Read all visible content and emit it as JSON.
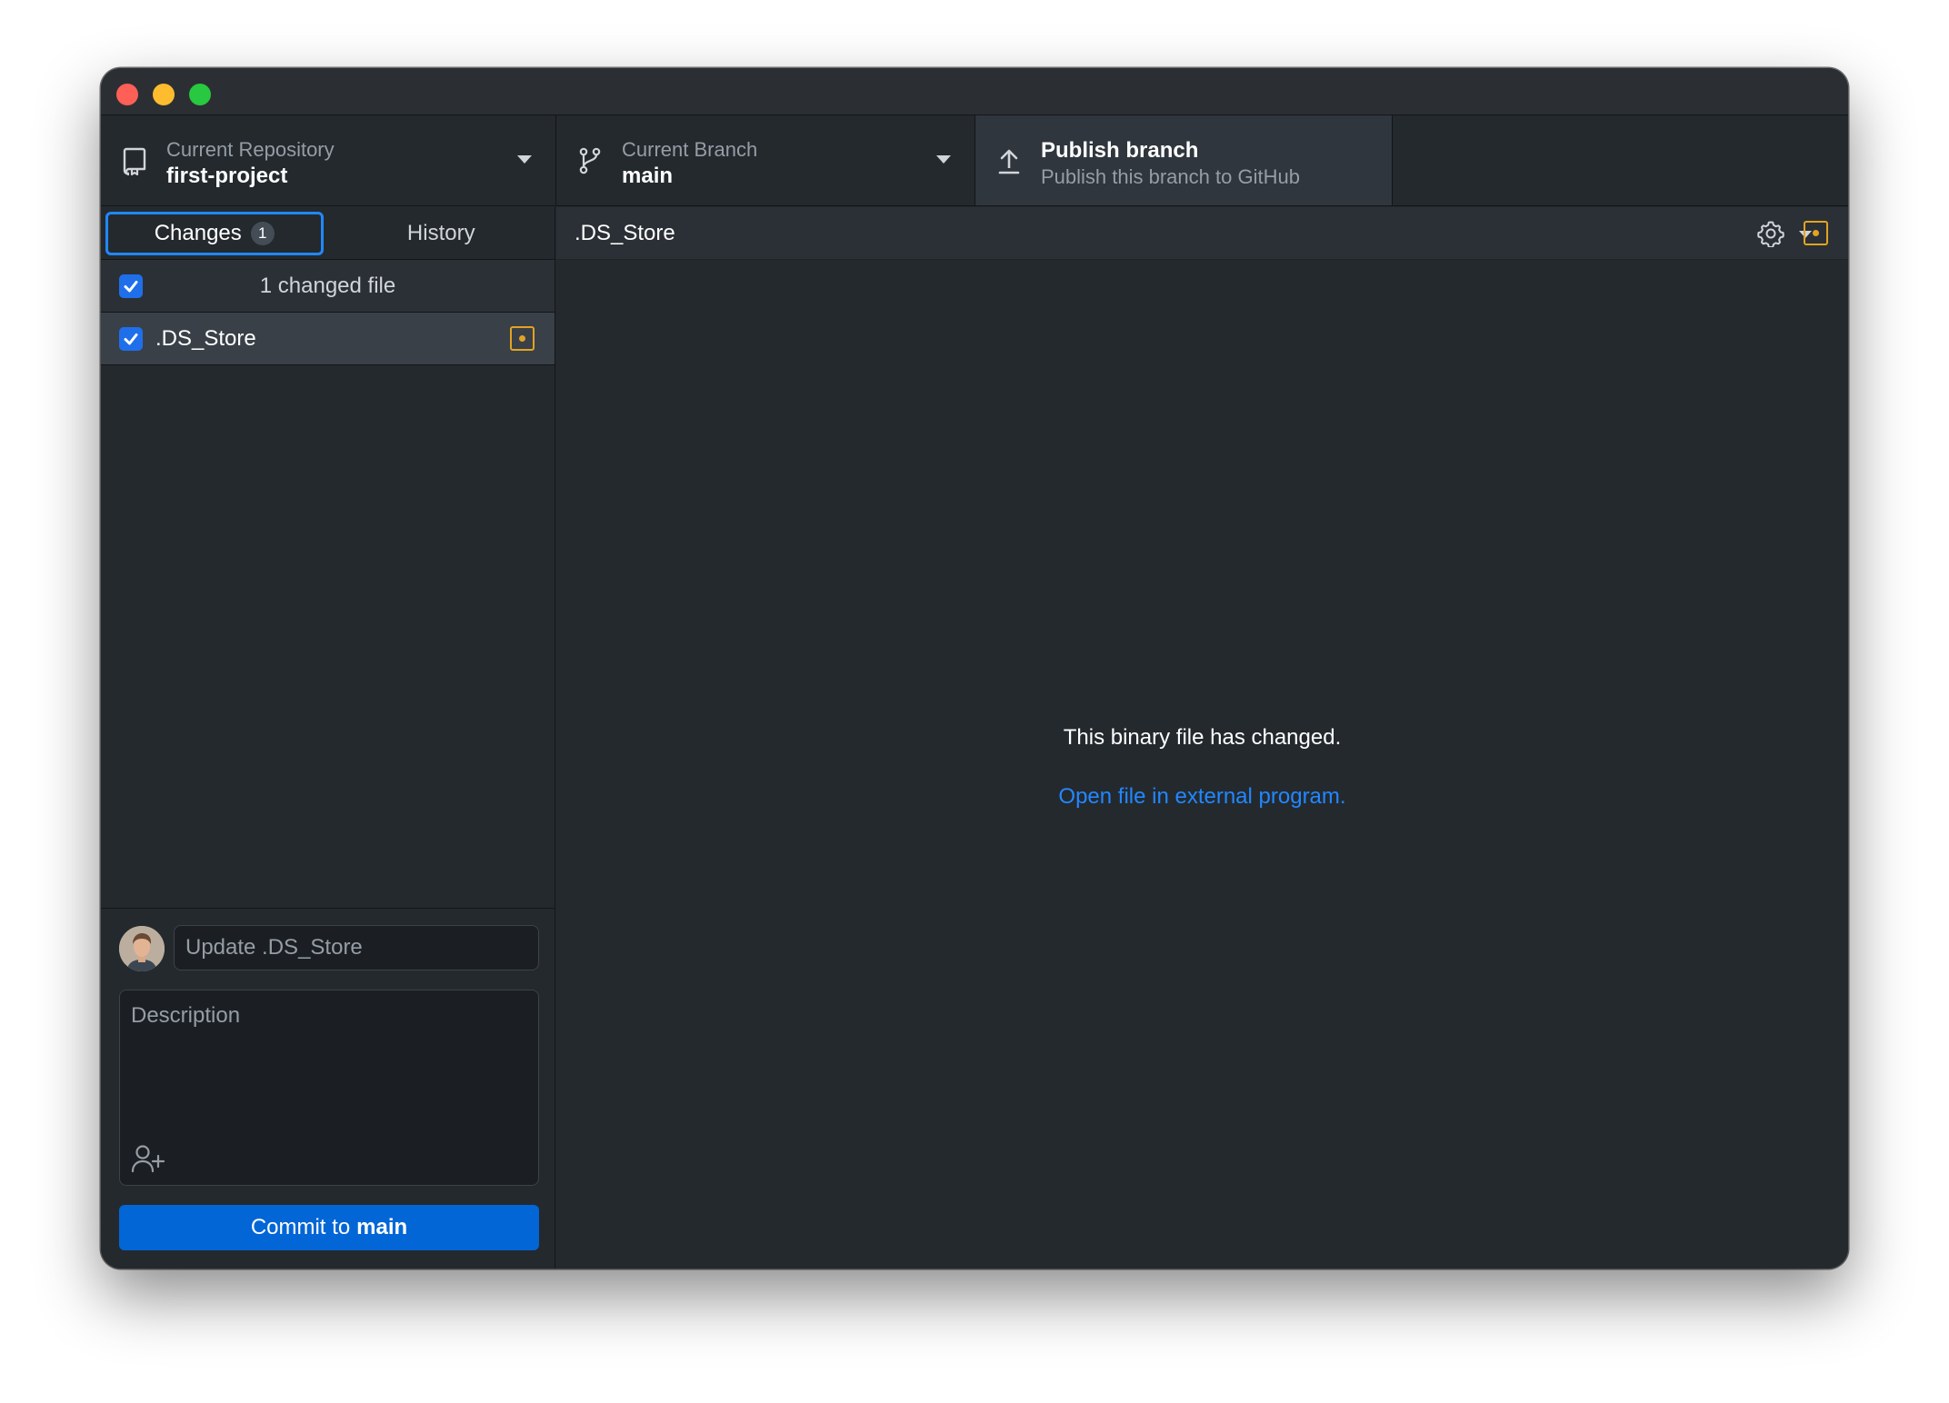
{
  "window": {
    "traffic_lights": [
      "close",
      "minimize",
      "zoom"
    ]
  },
  "toolbar": {
    "repository": {
      "label": "Current Repository",
      "value": "first-project",
      "icon": "repo-icon"
    },
    "branch": {
      "label": "Current Branch",
      "value": "main",
      "icon": "git-branch-icon"
    },
    "publish": {
      "label": "Publish branch",
      "sublabel": "Publish this branch to GitHub",
      "icon": "upload-icon"
    }
  },
  "sidebar": {
    "tabs": [
      {
        "label": "Changes",
        "badge": "1",
        "active": true
      },
      {
        "label": "History",
        "active": false
      }
    ],
    "changed_files_header": "1 changed file",
    "files": [
      {
        "name": ".DS_Store",
        "checked": true,
        "status": "modified"
      }
    ]
  },
  "commit": {
    "summary_placeholder": "Update .DS_Store",
    "description_placeholder": "Description",
    "button_prefix": "Commit to",
    "button_branch": "main"
  },
  "main": {
    "filename": ".DS_Store",
    "message": "This binary file has changed.",
    "link": "Open file in external program."
  },
  "colors": {
    "accent": "#2188ff",
    "button": "#0366d6",
    "modified": "#e3a321",
    "background": "#24292e"
  }
}
